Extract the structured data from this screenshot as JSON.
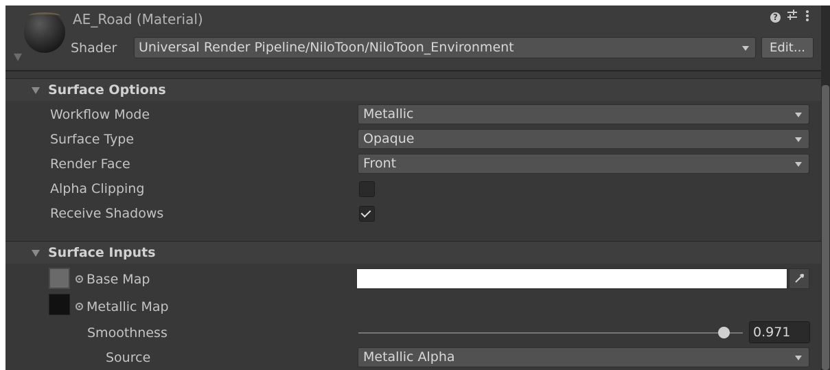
{
  "header": {
    "title": "AE_Road (Material)",
    "shader_label": "Shader",
    "shader_value": "Universal Render Pipeline/NiloToon/NiloToon_Environment",
    "edit_label": "Edit...",
    "icons": [
      "help-icon",
      "preset-icon",
      "more-icon"
    ]
  },
  "surface_options": {
    "title": "Surface Options",
    "workflow_mode": {
      "label": "Workflow Mode",
      "value": "Metallic"
    },
    "surface_type": {
      "label": "Surface Type",
      "value": "Opaque"
    },
    "render_face": {
      "label": "Render Face",
      "value": "Front"
    },
    "alpha_clipping": {
      "label": "Alpha Clipping",
      "checked": false
    },
    "receive_shadows": {
      "label": "Receive Shadows",
      "checked": true
    }
  },
  "surface_inputs": {
    "title": "Surface Inputs",
    "base_map": {
      "label": "Base Map",
      "color": "#ffffff"
    },
    "metallic_map": {
      "label": "Metallic Map"
    },
    "smoothness": {
      "label": "Smoothness",
      "value": "0.971"
    },
    "source": {
      "label": "Source",
      "value": "Metallic Alpha"
    }
  },
  "colors": {
    "panel_bg": "#383838",
    "section_header_bg": "#3e3e3e",
    "text": "#c4c4c4"
  }
}
